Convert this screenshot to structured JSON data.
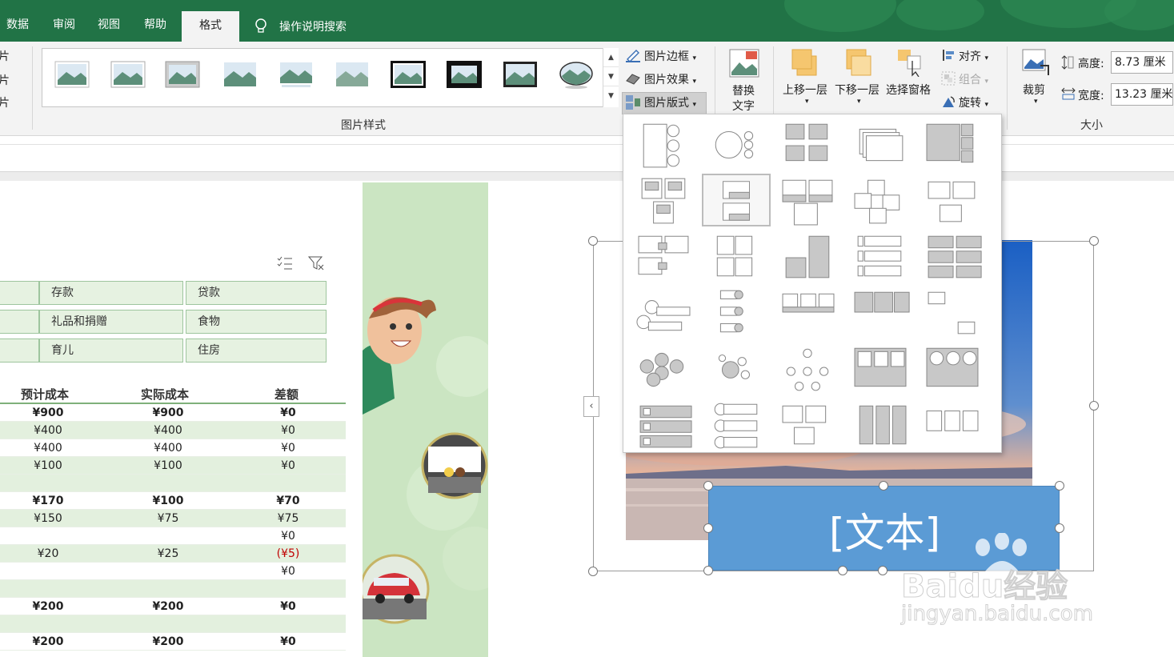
{
  "tabs": {
    "data": "数据",
    "review": "审阅",
    "view": "视图",
    "help": "帮助",
    "format": "格式",
    "search": "操作说明搜索"
  },
  "ribbon": {
    "left_stub": [
      "片",
      "片",
      "片"
    ],
    "picture_styles_label": "图片样式",
    "border": "图片边框",
    "effects": "图片效果",
    "layout": "图片版式",
    "alt_text_1": "替换",
    "alt_text_2": "文字",
    "bring_forward": "上移一层",
    "send_backward": "下移一层",
    "selection_pane": "选择窗格",
    "align": "对齐",
    "group": "组合",
    "rotate": "旋转",
    "crop": "裁剪",
    "height_label": "高度:",
    "height_value": "8.73 厘米",
    "width_label": "宽度:",
    "width_value": "13.23 厘米",
    "size_label": "大小"
  },
  "categories": [
    "存款",
    "贷款",
    "礼品和捐赠",
    "食物",
    "育儿",
    "住房"
  ],
  "table": {
    "headers": [
      "预计成本",
      "实际成本",
      "差额"
    ],
    "rows": [
      {
        "c": [
          "¥900",
          "¥900",
          "¥0"
        ],
        "bold": true,
        "shade": false
      },
      {
        "c": [
          "¥400",
          "¥400",
          "¥0"
        ],
        "bold": false,
        "shade": true
      },
      {
        "c": [
          "¥400",
          "¥400",
          "¥0"
        ],
        "bold": false,
        "shade": false
      },
      {
        "c": [
          "¥100",
          "¥100",
          "¥0"
        ],
        "bold": false,
        "shade": true
      },
      {
        "c": [
          "",
          "",
          ""
        ],
        "bold": false,
        "shade": true
      },
      {
        "c": [
          "¥170",
          "¥100",
          "¥70"
        ],
        "bold": true,
        "shade": false
      },
      {
        "c": [
          "¥150",
          "¥75",
          "¥75"
        ],
        "bold": false,
        "shade": true
      },
      {
        "c": [
          "",
          "",
          "¥0"
        ],
        "bold": false,
        "shade": false
      },
      {
        "c": [
          "¥20",
          "¥25",
          "(¥5)"
        ],
        "bold": false,
        "shade": true
      },
      {
        "c": [
          "",
          "",
          "¥0"
        ],
        "bold": false,
        "shade": false
      },
      {
        "c": [
          "",
          "",
          ""
        ],
        "bold": false,
        "shade": true
      },
      {
        "c": [
          "¥200",
          "¥200",
          "¥0"
        ],
        "bold": true,
        "shade": false
      },
      {
        "c": [
          "",
          "",
          ""
        ],
        "bold": false,
        "shade": true
      },
      {
        "c": [
          "¥200",
          "¥200",
          "¥0"
        ],
        "bold": true,
        "shade": false
      }
    ]
  },
  "smartart": {
    "text": "[文本]"
  },
  "watermark": {
    "line1": "Baidu经验",
    "line2": "jingyan.baidu.com"
  },
  "colors": {
    "excel_green": "#217346",
    "text_box": "#5b9bd5",
    "strip": "#cbe5c2"
  }
}
